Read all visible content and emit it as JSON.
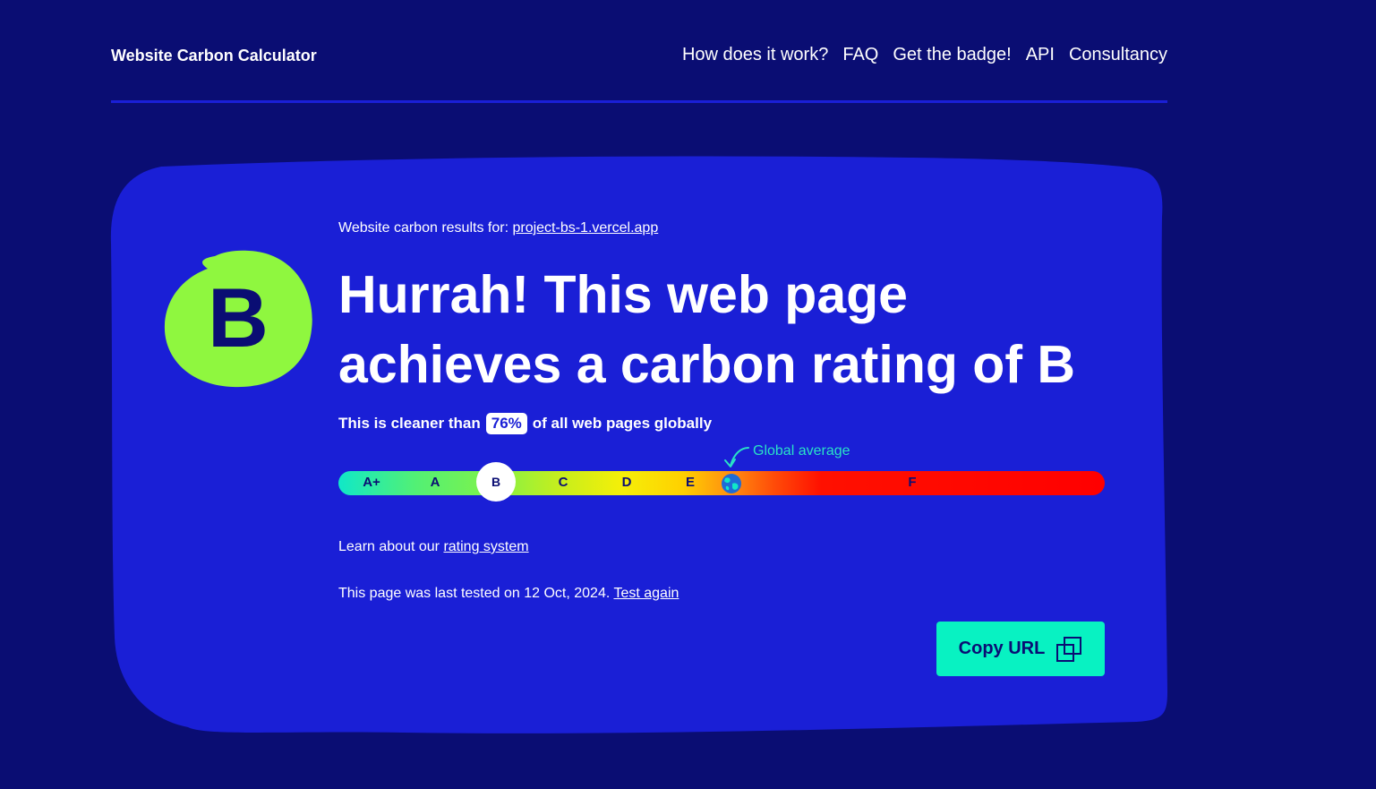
{
  "header": {
    "brand": "Website Carbon Calculator",
    "nav": [
      {
        "label": "How does it work?"
      },
      {
        "label": "FAQ"
      },
      {
        "label": "Get the badge!"
      },
      {
        "label": "API"
      },
      {
        "label": "Consultancy"
      }
    ]
  },
  "result": {
    "grade": "B",
    "results_for_prefix": "Website carbon results for:",
    "url": "project-bs-1.vercel.app",
    "headline": "Hurrah! This web page achieves a carbon rating of B",
    "cleaner_prefix": "This is cleaner than",
    "cleaner_percent": "76%",
    "cleaner_suffix": "of all web pages globally"
  },
  "scale": {
    "labels": [
      "A+",
      "A",
      "B",
      "C",
      "D",
      "E",
      "F"
    ],
    "current": "B",
    "global_average_label": "Global average",
    "global_average_icon": "globe-icon"
  },
  "footer_text": {
    "learn_prefix": "Learn about our",
    "learn_link": "rating system",
    "tested_text": "This page was last tested on 12 Oct, 2024.",
    "test_again": "Test again"
  },
  "copy_button": {
    "label": "Copy URL",
    "icon": "copy-icon"
  },
  "colors": {
    "background": "#0a0d73",
    "card": "#1a1fd6",
    "grade_badge": "#8ff73f",
    "accent": "#08f2c2"
  }
}
